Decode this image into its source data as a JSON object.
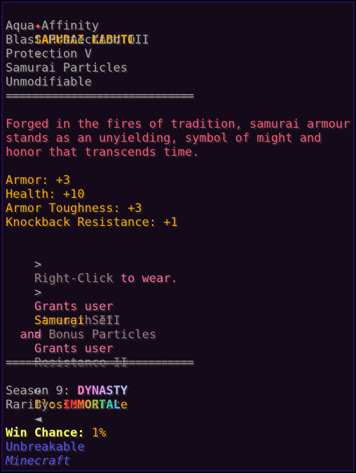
{
  "title": {
    "left_star": "✦",
    "text": "SAMURAI KABUTO",
    "right_star": "✦"
  },
  "enchantments": [
    "Aqua Affinity",
    "Blast Protection III",
    "Protection V",
    "Samurai Particles",
    "Unmodifiable"
  ],
  "separator": "=============================",
  "lore": [
    "Forged in the fires of tradition, samurai armour",
    "stands as an unyielding, symbol of might and",
    "honor that transcends time."
  ],
  "stats": [
    "Armor: +3",
    "Health: +10",
    "Armor Toughness: +3",
    "Knockback Resistance: +1"
  ],
  "abilities": {
    "arrow": ">",
    "right_click_a": "Right-Click",
    "right_click_b": " to wear.",
    "grants_a": "Grants user",
    "grants_b": "Strength III",
    "set_a": "Samurai",
    "set_b": " Set",
    "set_grants_a": "Grants user",
    "set_grants_b": "Resistance II",
    "set_and": "and",
    "set_particles": "Bonus Particles"
  },
  "crate": {
    "left_arrow": "►",
    "name": "Blossom Crate",
    "right_arrow": "◄"
  },
  "season": {
    "label": "Season 9: ",
    "name": "DYNASTY",
    "letters": [
      "D",
      "Y",
      "N",
      "A",
      "S",
      "T",
      "Y"
    ],
    "colors": [
      "#ff7ad0",
      "#f57ae0",
      "#e68af0",
      "#d79aff",
      "#c8a8ff",
      "#bfb4ff",
      "#b8c0ff"
    ]
  },
  "rarity": {
    "label": "Rarity: ",
    "letters": [
      "I",
      "M",
      "M",
      "O",
      "R",
      "T",
      "A",
      "L"
    ],
    "colors": [
      "#ff3030",
      "#ff3030",
      "#ff6a30",
      "#e0a030",
      "#a0c040",
      "#40d080",
      "#30d0c0",
      "#40c0ff"
    ]
  },
  "win_chance": {
    "label": "Win Chance:",
    "value": " 1%"
  },
  "unbreakable": "Unbreakable",
  "source": "Minecraft"
}
